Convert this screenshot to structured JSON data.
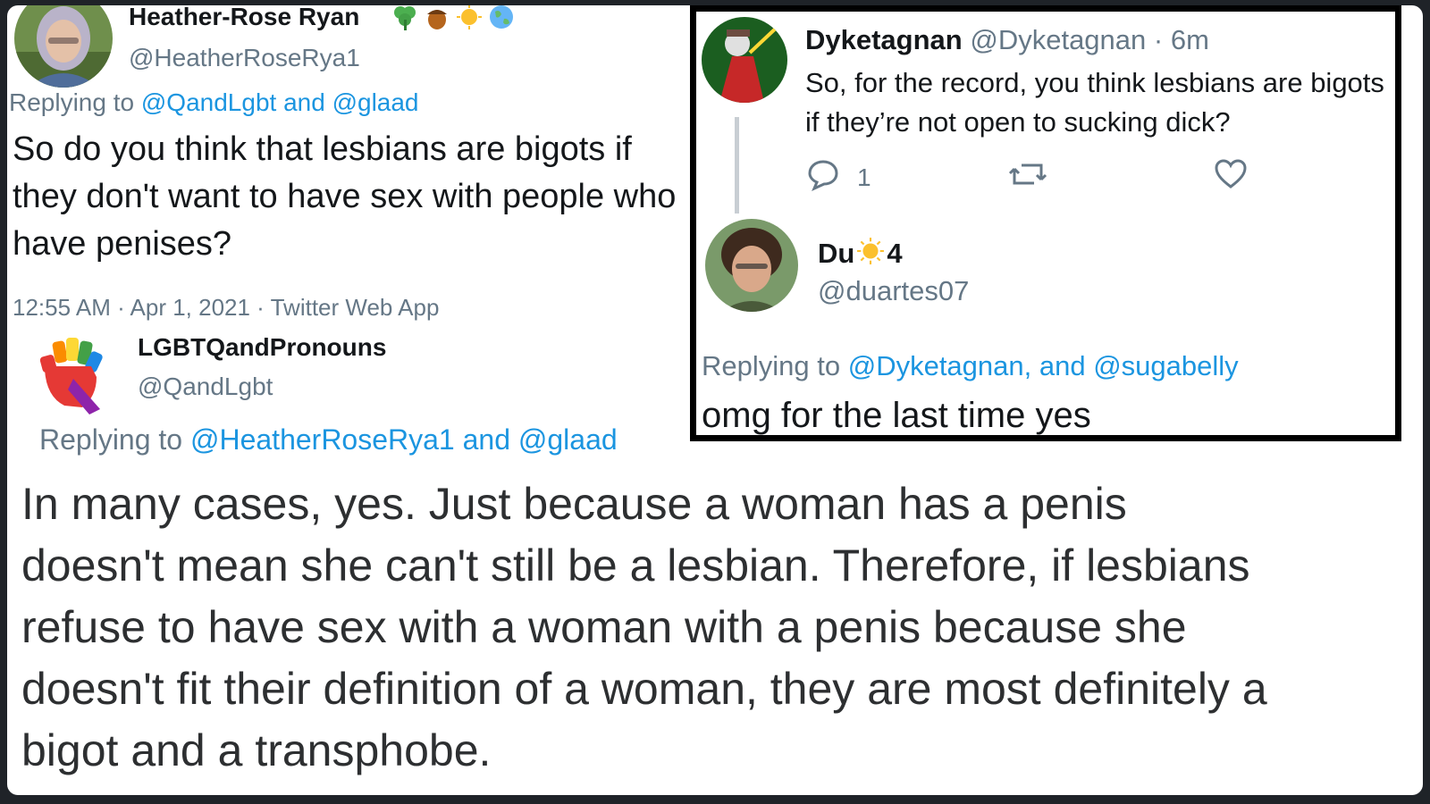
{
  "tweet1": {
    "display_name": "Heather-Rose Ryan",
    "name_emojis": [
      "shamrock-emoji",
      "acorn-emoji",
      "sun-emoji",
      "earth-globe-emoji"
    ],
    "handle": "@HeatherRoseRya1",
    "replying_prefix": "Replying to",
    "replying_mentions": "@QandLgbt and @glaad",
    "text": "So do you think that lesbians are bigots if they don't want to have sex with people who have penises?",
    "meta": "12:55 AM · Apr 1, 2021 · Twitter Web App"
  },
  "tweet2": {
    "display_name": "LGBTQandPronouns",
    "handle": "@QandLgbt",
    "replying_prefix": "Replying to",
    "replying_mentions": "@HeatherRoseRya1 and @glaad",
    "text": "In many cases, yes.  Just because a woman has a penis doesn't mean she can't still be a lesbian.  Therefore, if lesbians refuse to have sex with a woman with a penis because she doesn't fit their definition of a woman, they are most definitely a bigot and a transphobe."
  },
  "panel": {
    "tweet": {
      "display_name": "Dyketagnan",
      "handle": "@Dyketagnan",
      "time": "· 6m",
      "text": "So, for the record, you think lesbians are bigots if they’re not open to sucking dick?",
      "reply_count": "1",
      "icons": [
        "reply-icon",
        "retweet-icon",
        "like-icon"
      ]
    },
    "reply": {
      "display_name_start": "Du",
      "display_name_emoji": "sun-emoji",
      "display_name_end": "4",
      "handle": "@duartes07",
      "replying_prefix": "Replying to",
      "replying_mentions": "@Dyketagnan, and @sugabelly",
      "text": "omg for the last time yes"
    }
  },
  "colors": {
    "link": "#1b95e0",
    "muted": "#657786",
    "text": "#14171a",
    "frame": "#1f2328",
    "panel_border": "#000000"
  }
}
